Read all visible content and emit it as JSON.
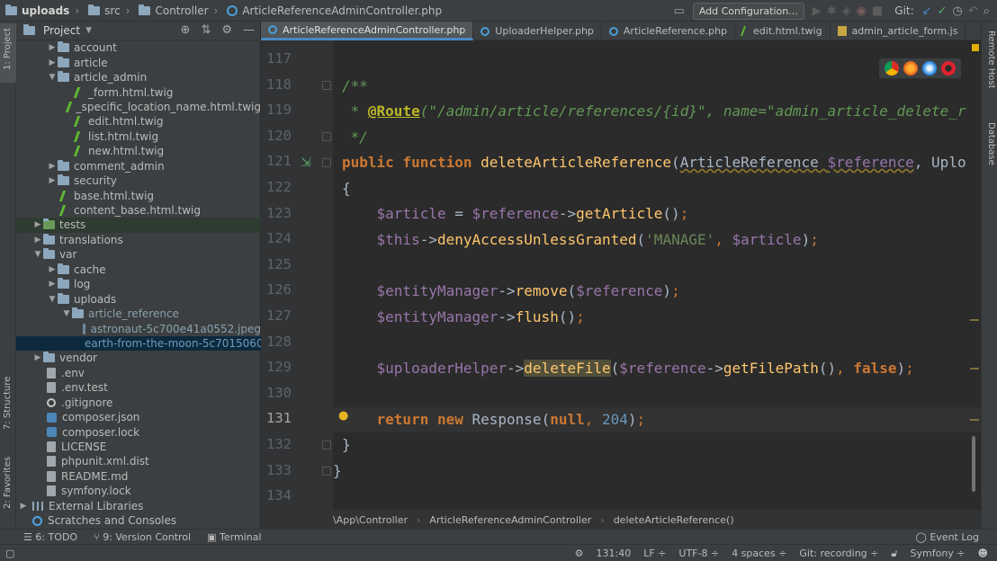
{
  "breadcrumb": {
    "root": "uploads",
    "items": [
      "src",
      "Controller",
      "ArticleReferenceAdminController.php"
    ]
  },
  "toolbar": {
    "add_configuration": "Add Configuration...",
    "git_label": "Git:"
  },
  "left_strip": {
    "project": "1: Project",
    "structure": "7: Structure",
    "favorites": "2: Favorites"
  },
  "right_strip": {
    "remote_host": "Remote Host",
    "database": "Database"
  },
  "project_panel": {
    "title": "Project",
    "tree": [
      {
        "label": "account",
        "type": "folder",
        "depth": 2,
        "arrow": "▶"
      },
      {
        "label": "article",
        "type": "folder",
        "depth": 2,
        "arrow": "▶"
      },
      {
        "label": "article_admin",
        "type": "folder",
        "depth": 2,
        "arrow": "▼"
      },
      {
        "label": "_form.html.twig",
        "type": "twig",
        "depth": 3,
        "arrow": ""
      },
      {
        "label": "_specific_location_name.html.twig",
        "type": "twig",
        "depth": 3,
        "arrow": ""
      },
      {
        "label": "edit.html.twig",
        "type": "twig",
        "depth": 3,
        "arrow": ""
      },
      {
        "label": "list.html.twig",
        "type": "twig",
        "depth": 3,
        "arrow": ""
      },
      {
        "label": "new.html.twig",
        "type": "twig",
        "depth": 3,
        "arrow": ""
      },
      {
        "label": "comment_admin",
        "type": "folder",
        "depth": 2,
        "arrow": "▶"
      },
      {
        "label": "security",
        "type": "folder",
        "depth": 2,
        "arrow": "▶"
      },
      {
        "label": "base.html.twig",
        "type": "twig",
        "depth": 2,
        "arrow": ""
      },
      {
        "label": "content_base.html.twig",
        "type": "twig",
        "depth": 2,
        "arrow": ""
      },
      {
        "label": "tests",
        "type": "folder-green",
        "depth": 1,
        "arrow": "▶",
        "state": "tests"
      },
      {
        "label": "translations",
        "type": "folder",
        "depth": 1,
        "arrow": "▶"
      },
      {
        "label": "var",
        "type": "folder",
        "depth": 1,
        "arrow": "▼"
      },
      {
        "label": "cache",
        "type": "folder",
        "depth": 2,
        "arrow": "▶"
      },
      {
        "label": "log",
        "type": "folder",
        "depth": 2,
        "arrow": "▶"
      },
      {
        "label": "uploads",
        "type": "folder",
        "depth": 2,
        "arrow": "▼"
      },
      {
        "label": "article_reference",
        "type": "folder",
        "depth": 3,
        "arrow": "▼",
        "state": "muted"
      },
      {
        "label": "astronaut-5c700e41a0552.jpeg",
        "type": "image",
        "depth": 4,
        "arrow": "",
        "state": "muted"
      },
      {
        "label": "earth-from-the-moon-5c7015060",
        "type": "image",
        "depth": 4,
        "arrow": "",
        "state": "selected"
      },
      {
        "label": "vendor",
        "type": "folder",
        "depth": 1,
        "arrow": "▶"
      },
      {
        "label": ".env",
        "type": "file",
        "depth": 1,
        "arrow": ""
      },
      {
        "label": ".env.test",
        "type": "file",
        "depth": 1,
        "arrow": ""
      },
      {
        "label": ".gitignore",
        "type": "git",
        "depth": 1,
        "arrow": ""
      },
      {
        "label": "composer.json",
        "type": "composer",
        "depth": 1,
        "arrow": ""
      },
      {
        "label": "composer.lock",
        "type": "composer",
        "depth": 1,
        "arrow": ""
      },
      {
        "label": "LICENSE",
        "type": "file",
        "depth": 1,
        "arrow": ""
      },
      {
        "label": "phpunit.xml.dist",
        "type": "file",
        "depth": 1,
        "arrow": ""
      },
      {
        "label": "README.md",
        "type": "file",
        "depth": 1,
        "arrow": ""
      },
      {
        "label": "symfony.lock",
        "type": "file",
        "depth": 1,
        "arrow": ""
      },
      {
        "label": "External Libraries",
        "type": "library",
        "depth": 0,
        "arrow": "▶"
      },
      {
        "label": "Scratches and Consoles",
        "type": "scratch",
        "depth": 0,
        "arrow": ""
      }
    ]
  },
  "tabs": [
    {
      "label": "ArticleReferenceAdminController.php",
      "type": "php",
      "active": true
    },
    {
      "label": "UploaderHelper.php",
      "type": "php",
      "active": false
    },
    {
      "label": "ArticleReference.php",
      "type": "php",
      "active": false
    },
    {
      "label": "edit.html.twig",
      "type": "twig",
      "active": false
    },
    {
      "label": "admin_article_form.js",
      "type": "js",
      "active": false
    }
  ],
  "editor": {
    "line_numbers": [
      "117",
      "118",
      "119",
      "120",
      "121",
      "122",
      "123",
      "124",
      "125",
      "126",
      "127",
      "128",
      "129",
      "130",
      "131",
      "132",
      "133",
      "134"
    ],
    "current_line": "131"
  },
  "editor_breadcrumb": [
    "\\App\\Controller",
    "ArticleReferenceAdminController",
    "deleteArticleReference()"
  ],
  "tool_windows": {
    "todo": "6: TODO",
    "version_control": "9: Version Control",
    "terminal": "Terminal",
    "event_log": "Event Log"
  },
  "status_bar": {
    "position": "131:40",
    "line_ending": "LF ÷",
    "encoding": "UTF-8 ÷",
    "indent": "4 spaces ÷",
    "git": "Git: recording ÷",
    "framework": "Symfony ÷"
  },
  "colors": {
    "keyword": "#cc7832",
    "variable": "#9876aa",
    "function": "#ffc66d",
    "string": "#6a8759",
    "number": "#6897bb",
    "doc_comment": "#629755"
  }
}
